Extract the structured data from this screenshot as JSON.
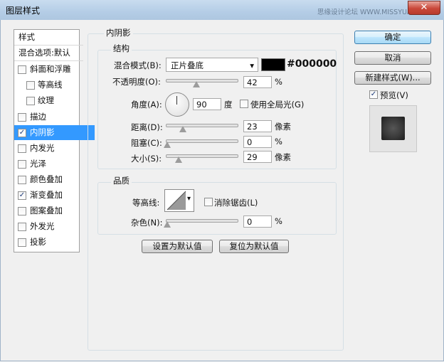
{
  "window": {
    "title": "图层样式",
    "watermark": "思缘设计论坛 WWW.MISSYUAN.COM",
    "close_glyph": "✕"
  },
  "left_panel": {
    "header": "样式",
    "blending": "混合选项:默认",
    "items": [
      {
        "label": "斜面和浮雕",
        "checked": false,
        "sub": false
      },
      {
        "label": "等高线",
        "checked": false,
        "sub": true
      },
      {
        "label": "纹理",
        "checked": false,
        "sub": true
      },
      {
        "label": "描边",
        "checked": false,
        "sub": false
      },
      {
        "label": "内阴影",
        "checked": true,
        "sub": false,
        "selected": true
      },
      {
        "label": "内发光",
        "checked": false,
        "sub": false
      },
      {
        "label": "光泽",
        "checked": false,
        "sub": false
      },
      {
        "label": "颜色叠加",
        "checked": false,
        "sub": false
      },
      {
        "label": "渐变叠加",
        "checked": true,
        "sub": false
      },
      {
        "label": "图案叠加",
        "checked": false,
        "sub": false
      },
      {
        "label": "外发光",
        "checked": false,
        "sub": false
      },
      {
        "label": "投影",
        "checked": false,
        "sub": false
      }
    ]
  },
  "section_title": "内阴影",
  "structure": {
    "title": "结构",
    "blend_mode_label": "混合模式(B):",
    "blend_mode_value": "正片叠底",
    "color_hex": "#000000",
    "opacity_label": "不透明度(O):",
    "opacity_value": "42",
    "angle_label": "角度(A):",
    "angle_value": "90",
    "angle_unit": "度",
    "global_light_label": "使用全局光(G)",
    "distance_label": "距离(D):",
    "distance_value": "23",
    "choke_label": "阻塞(C):",
    "choke_value": "0",
    "size_label": "大小(S):",
    "size_value": "29",
    "unit_percent": "%",
    "unit_pixels": "像素"
  },
  "quality": {
    "title": "品质",
    "contour_label": "等高线:",
    "antialias_label": "消除锯齿(L)",
    "noise_label": "杂色(N):",
    "noise_value": "0",
    "unit_percent": "%"
  },
  "buttons": {
    "make_default": "设置为默认值",
    "reset_default": "复位为默认值",
    "ok": "确定",
    "cancel": "取消",
    "new_style": "新建样式(W)...",
    "preview_label": "预览(V)"
  },
  "icons": {
    "check": "✓",
    "dropdown": "▾"
  },
  "colors": {
    "selected": "#3399ff",
    "swatch": "#000000"
  }
}
